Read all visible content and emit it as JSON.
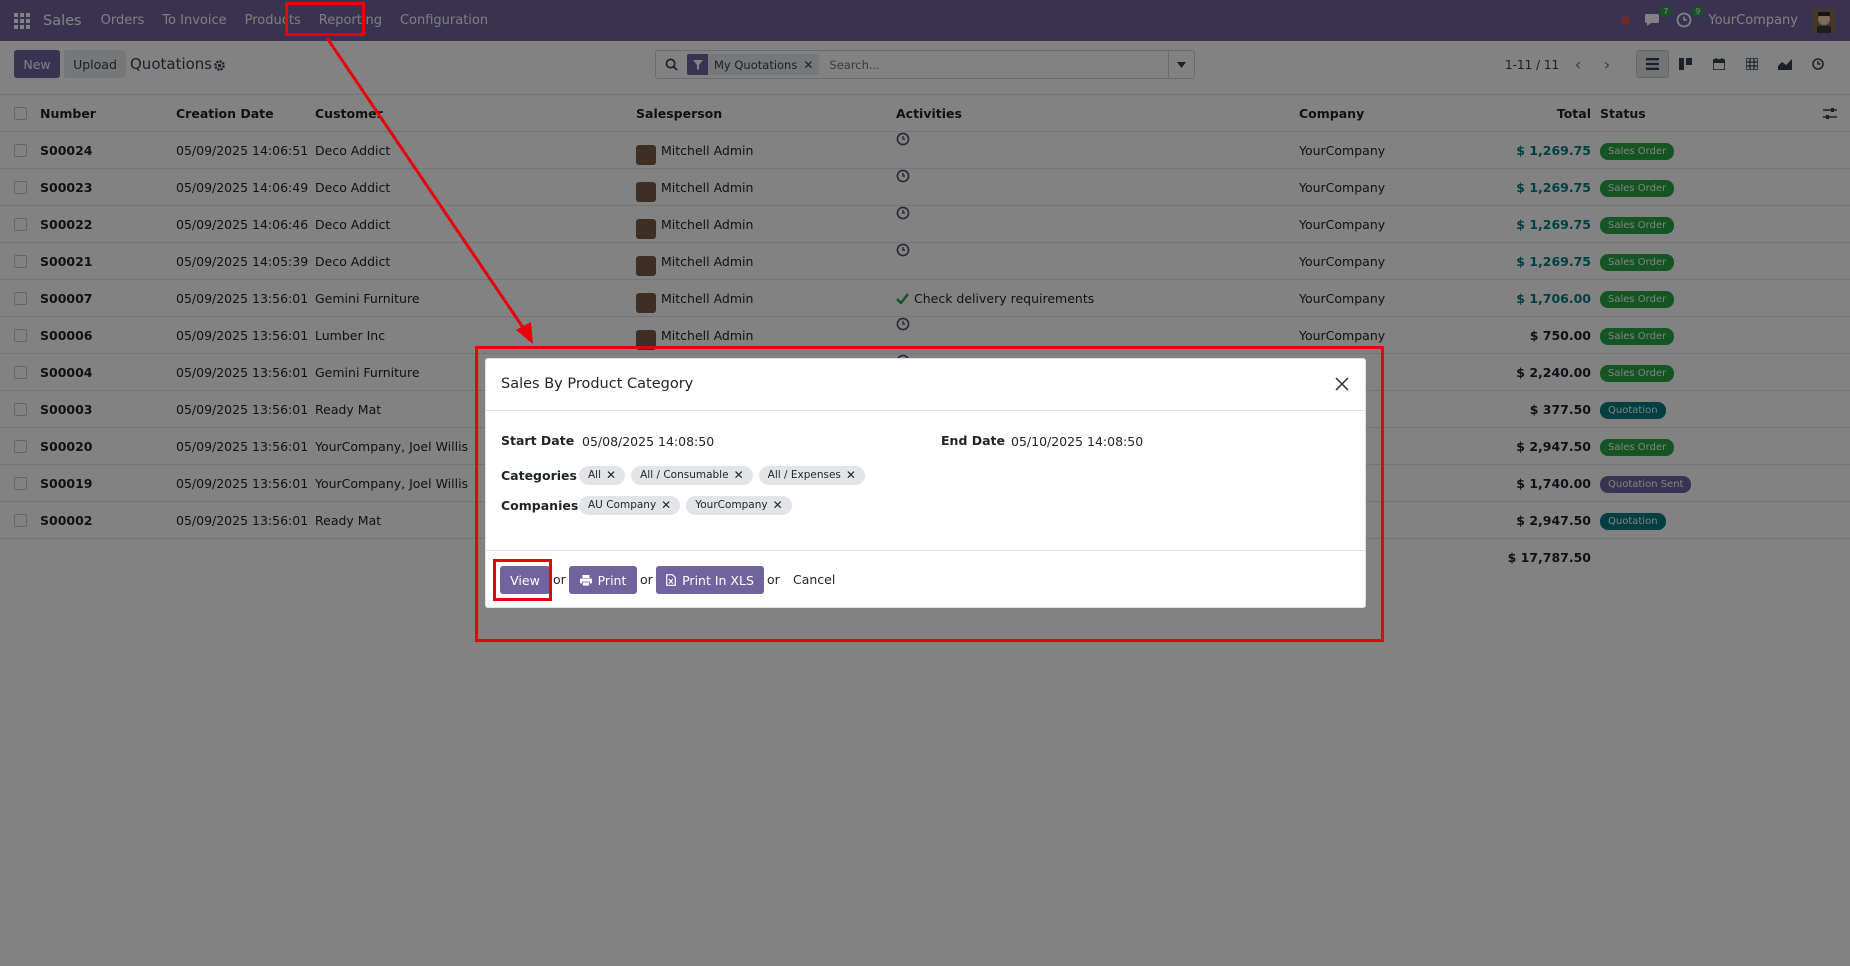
{
  "navbar": {
    "app_name": "Sales",
    "menu": [
      "Orders",
      "To Invoice",
      "Products",
      "Reporting",
      "Configuration"
    ],
    "messages_count": "7",
    "activities_count": "9",
    "company": "YourCompany"
  },
  "control": {
    "new_label": "New",
    "upload_label": "Upload",
    "title": "Quotations",
    "facet_label": "My Quotations",
    "search_placeholder": "Search...",
    "pager": "1-11 / 11"
  },
  "columns": {
    "number": "Number",
    "date": "Creation Date",
    "customer": "Customer",
    "salesperson": "Salesperson",
    "activities": "Activities",
    "company": "Company",
    "total": "Total",
    "status": "Status"
  },
  "rows": [
    {
      "number": "S00024",
      "date": "05/09/2025 14:06:51",
      "customer": "Deco Addict",
      "salesperson": "Mitchell Admin",
      "activity": "",
      "company": "YourCompany",
      "total": "$ 1,269.75",
      "status": "Sales Order"
    },
    {
      "number": "S00023",
      "date": "05/09/2025 14:06:49",
      "customer": "Deco Addict",
      "salesperson": "Mitchell Admin",
      "activity": "",
      "company": "YourCompany",
      "total": "$ 1,269.75",
      "status": "Sales Order"
    },
    {
      "number": "S00022",
      "date": "05/09/2025 14:06:46",
      "customer": "Deco Addict",
      "salesperson": "Mitchell Admin",
      "activity": "",
      "company": "YourCompany",
      "total": "$ 1,269.75",
      "status": "Sales Order"
    },
    {
      "number": "S00021",
      "date": "05/09/2025 14:05:39",
      "customer": "Deco Addict",
      "salesperson": "Mitchell Admin",
      "activity": "",
      "company": "YourCompany",
      "total": "$ 1,269.75",
      "status": "Sales Order"
    },
    {
      "number": "S00007",
      "date": "05/09/2025 13:56:01",
      "customer": "Gemini Furniture",
      "salesperson": "Mitchell Admin",
      "activity": "Check delivery requirements",
      "company": "YourCompany",
      "total": "$ 1,706.00",
      "status": "Sales Order"
    },
    {
      "number": "S00006",
      "date": "05/09/2025 13:56:01",
      "customer": "Lumber Inc",
      "salesperson": "Mitchell Admin",
      "activity": "",
      "company": "YourCompany",
      "total": "$ 750.00",
      "status": "Sales Order"
    },
    {
      "number": "S00004",
      "date": "05/09/2025 13:56:01",
      "customer": "Gemini Furniture",
      "salesperson": "",
      "activity": "",
      "company": "ny",
      "total": "$ 2,240.00",
      "status": "Sales Order"
    },
    {
      "number": "S00003",
      "date": "05/09/2025 13:56:01",
      "customer": "Ready Mat",
      "salesperson": "",
      "activity": "",
      "company": "ny",
      "total": "$ 377.50",
      "status": "Quotation"
    },
    {
      "number": "S00020",
      "date": "05/09/2025 13:56:01",
      "customer": "YourCompany, Joel Willis",
      "salesperson": "",
      "activity": "",
      "company": "ny",
      "total": "$ 2,947.50",
      "status": "Sales Order"
    },
    {
      "number": "S00019",
      "date": "05/09/2025 13:56:01",
      "customer": "YourCompany, Joel Willis",
      "salesperson": "",
      "activity": "",
      "company": "ny",
      "total": "$ 1,740.00",
      "status": "Quotation Sent"
    },
    {
      "number": "S00002",
      "date": "05/09/2025 13:56:01",
      "customer": "Ready Mat",
      "salesperson": "",
      "activity": "",
      "company": "ny",
      "total": "$ 2,947.50",
      "status": "Quotation"
    }
  ],
  "sum_total": "$ 17,787.50",
  "status_colors": {
    "Sales Order": "#28a745",
    "Quotation": "#017e84",
    "Quotation Sent": "#71639e"
  },
  "dialog": {
    "title": "Sales By Product Category",
    "start_label": "Start Date",
    "start_value": "05/08/2025 14:08:50",
    "end_label": "End Date",
    "end_value": "05/10/2025 14:08:50",
    "categories_label": "Categories",
    "categories": [
      "All",
      "All / Consumable",
      "All / Expenses"
    ],
    "companies_label": "Companies",
    "companies": [
      "AU Company",
      "YourCompany"
    ],
    "view_label": "View",
    "print_label": "Print",
    "xls_label": "Print In XLS",
    "or": "or",
    "cancel_label": "Cancel"
  },
  "theme": {
    "primary": "#71639e",
    "link": "#017e84",
    "annotation": "#e8000b"
  }
}
